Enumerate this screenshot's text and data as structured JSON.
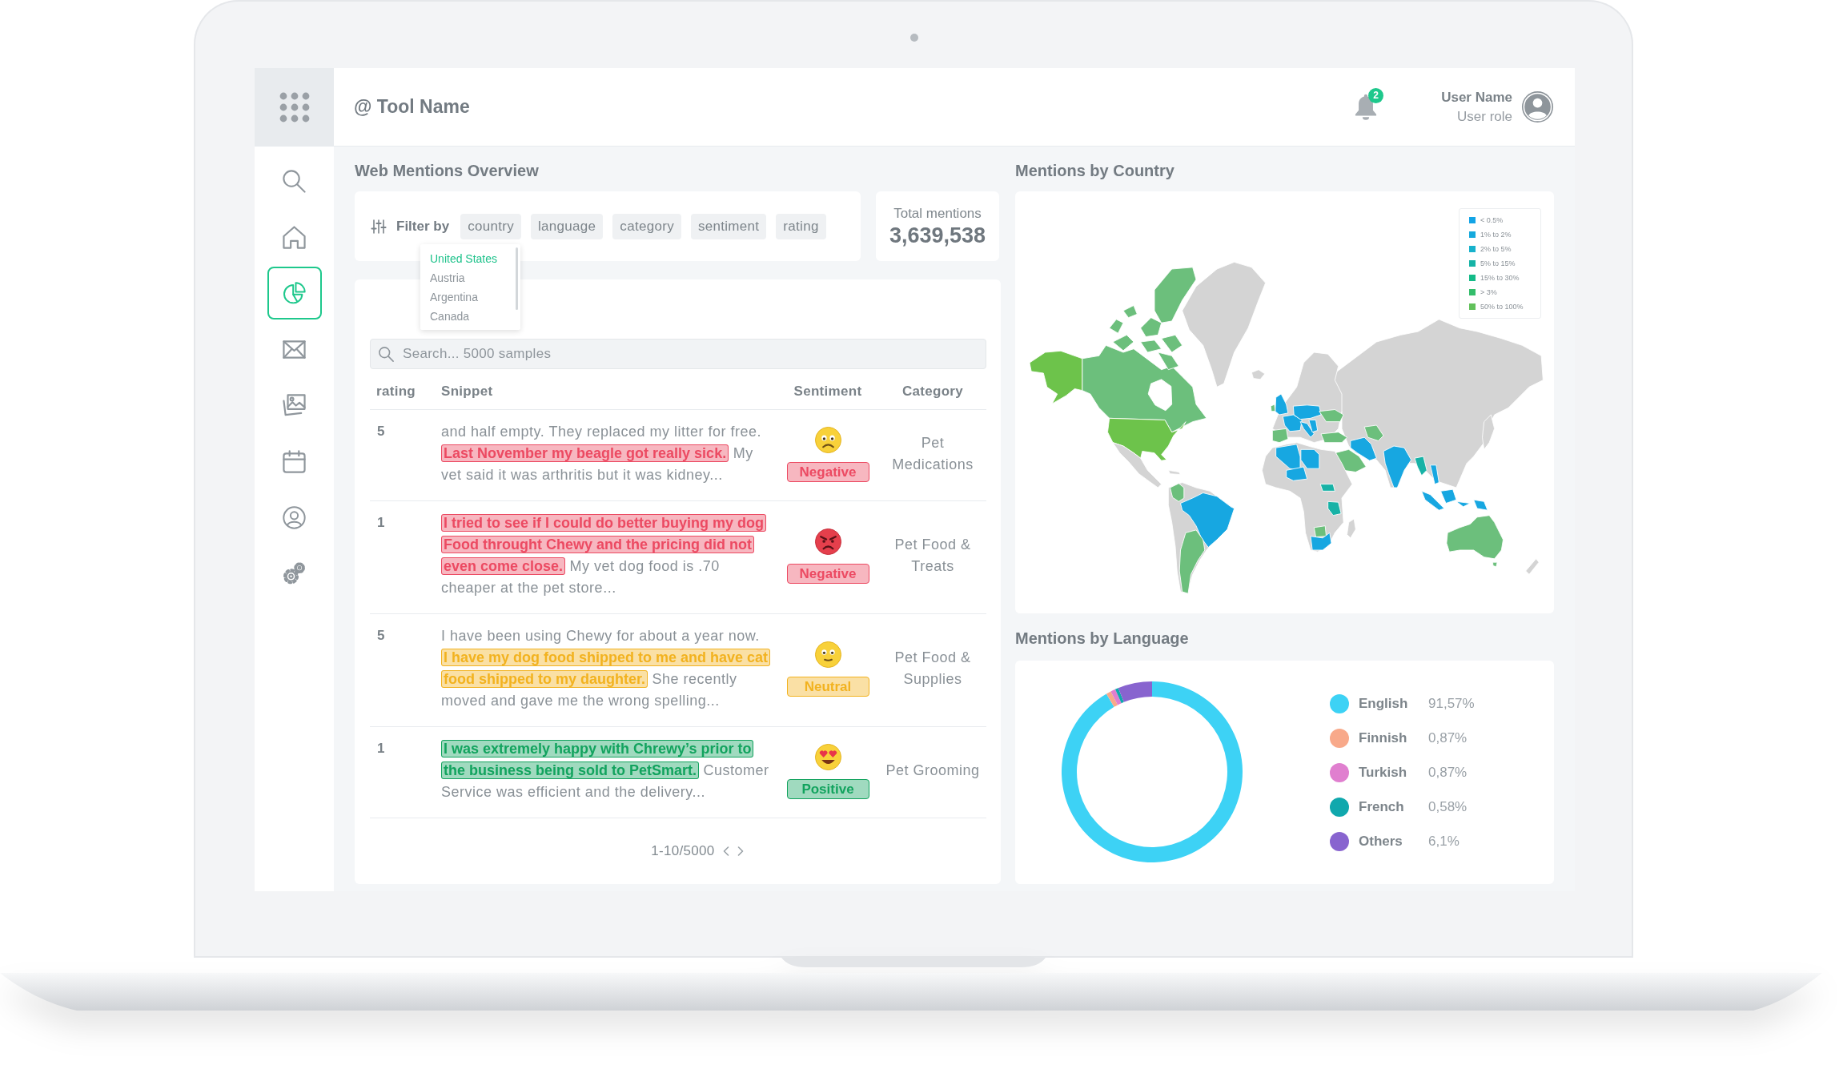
{
  "app_bar": {
    "title": "@ Tool Name",
    "notification_count": "2",
    "user": {
      "name": "User Name",
      "role": "User role"
    }
  },
  "sidebar": {
    "items": [
      {
        "kind": "search",
        "selected": false
      },
      {
        "kind": "home",
        "selected": false
      },
      {
        "kind": "chart",
        "selected": true
      },
      {
        "kind": "mail",
        "selected": false
      },
      {
        "kind": "images",
        "selected": false
      },
      {
        "kind": "calendar",
        "selected": false
      },
      {
        "kind": "profile",
        "selected": false
      },
      {
        "kind": "settings",
        "selected": false
      }
    ]
  },
  "overview": {
    "title": "Web Mentions Overview",
    "filter": {
      "label": "Filter by",
      "chips": [
        "country",
        "language",
        "category",
        "sentiment",
        "rating"
      ]
    },
    "dropdown": {
      "options": [
        {
          "label": "United States",
          "selected": true
        },
        {
          "label": "Austria",
          "selected": false
        },
        {
          "label": "Argentina",
          "selected": false
        },
        {
          "label": "Canada",
          "selected": false
        }
      ]
    },
    "total": {
      "label": "Total mentions",
      "value": "3,639,538"
    },
    "table": {
      "search": {
        "placeholder": "Search... 5000 samples"
      },
      "columns": [
        "rating",
        "Snippet",
        "Sentiment",
        "Category"
      ],
      "rows": [
        {
          "rating": "5",
          "snippet": [
            {
              "text": "and half empty. They replaced my litter for free.",
              "highlighted": false
            },
            {
              "text": "Last November my beagle got really sick.",
              "highlighted": true
            },
            {
              "text": "My vet said it was arthritis but it was kidney...",
              "highlighted": false
            }
          ],
          "sentiment": {
            "label": "Negative",
            "kind": "worried",
            "color": "#ec4a62"
          },
          "category": "Pet Medications"
        },
        {
          "rating": "1",
          "snippet": [
            {
              "text": "I tried to see if I could do better buying my dog Food throught Chewy and the pricing did not even come close.",
              "highlighted": true
            },
            {
              "text": "My vet dog food is .70 cheaper at the pet store...",
              "highlighted": false
            }
          ],
          "sentiment": {
            "label": "Negative",
            "kind": "angry",
            "color": "#ec4a62"
          },
          "category": "Pet Food & Treats"
        },
        {
          "rating": "5",
          "snippet": [
            {
              "text": "I have been using Chewy for about a year now.",
              "highlighted": false
            },
            {
              "text": "I have my dog food shipped to me and have cat food shipped to my daughter.",
              "highlighted": true
            },
            {
              "text": "She recently moved and gave me the wrong spelling...",
              "highlighted": false
            }
          ],
          "sentiment": {
            "label": "Neutral",
            "kind": "neutral",
            "color": "#f2b21f"
          },
          "category": "Pet Food & Supplies"
        },
        {
          "rating": "1",
          "snippet": [
            {
              "text": "I was extremely happy with Chrewy’s prior to the business being sold to PetSmart.",
              "highlighted": true
            },
            {
              "text": "Customer Service was efficient and the delivery...",
              "highlighted": false
            }
          ],
          "sentiment": {
            "label": "Positive",
            "kind": "love",
            "color": "#12a35e"
          },
          "category": "Pet Grooming"
        }
      ],
      "pagination": "1-10/5000"
    }
  },
  "country": {
    "title": "Mentions by Country",
    "legend": [
      {
        "label": "< 0.5%",
        "color": "#12a4e6"
      },
      {
        "label": "1% to 2%",
        "color": "#16a9dc"
      },
      {
        "label": "2% to 5%",
        "color": "#17b2cc"
      },
      {
        "label": "5% to 15%",
        "color": "#16b3a6"
      },
      {
        "label": "15% to 30%",
        "color": "#14bb88"
      },
      {
        "label": "> 3%",
        "color": "#33bd6b"
      },
      {
        "label": "50% to 100%",
        "color": "#62c15b"
      }
    ]
  },
  "language": {
    "title": "Mentions by Language",
    "chart_data": {
      "type": "donut",
      "categories": [
        "English",
        "Finnish",
        "Turkish",
        "French",
        "Others"
      ],
      "values": [
        91.57,
        0.87,
        0.87,
        0.58,
        6.1
      ]
    },
    "legend": [
      {
        "value": "91,57%",
        "color": "#3dd2f5"
      },
      {
        "value": "0,87%",
        "color": "#f8a98a"
      },
      {
        "value": "0,87%",
        "color": "#e07fcf"
      },
      {
        "value": "0,58%",
        "color": "#10a8ad"
      },
      {
        "value": "6,1%",
        "color": "#8864cf"
      }
    ]
  }
}
